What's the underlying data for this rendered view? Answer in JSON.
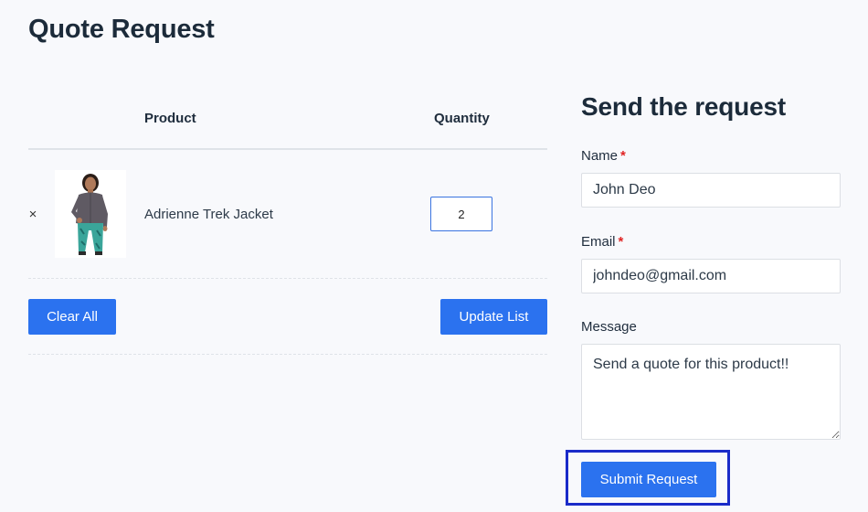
{
  "page": {
    "title": "Quote Request"
  },
  "table": {
    "headers": {
      "product": "Product",
      "quantity": "Quantity"
    },
    "rows": [
      {
        "remove": "×",
        "name": "Adrienne Trek Jacket",
        "quantity": "2"
      }
    ],
    "actions": {
      "clear_label": "Clear All",
      "update_label": "Update List"
    }
  },
  "form": {
    "title": "Send the request",
    "name": {
      "label": "Name",
      "required_mark": "*",
      "value": "John Deo"
    },
    "email": {
      "label": "Email",
      "required_mark": "*",
      "value": "johndeo@gmail.com"
    },
    "message": {
      "label": "Message",
      "value": "Send a quote for this product!!"
    },
    "submit_label": "Submit Request"
  },
  "colors": {
    "accent": "#2b72ef",
    "required": "#e02424",
    "highlight": "#1a2bc9"
  }
}
